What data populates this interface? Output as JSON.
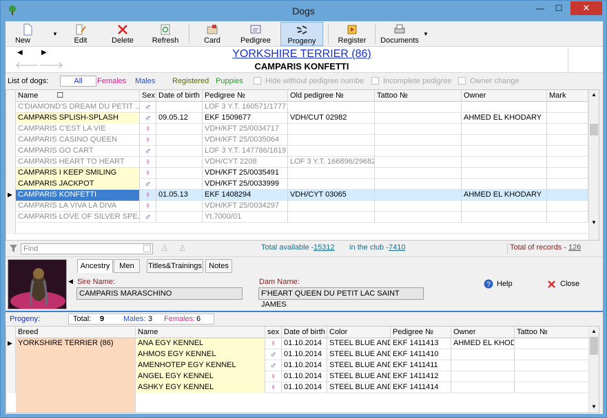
{
  "window": {
    "title": "Dogs",
    "minimize": "—",
    "maximize": "☐",
    "close": "✕"
  },
  "toolbar": {
    "new": "New",
    "edit": "Edit",
    "delete": "Delete",
    "refresh": "Refresh",
    "card": "Card",
    "pedigree": "Pedigree",
    "progeny": "Progeny",
    "register": "Register",
    "documents": "Documents"
  },
  "header": {
    "breed_title": "YORKSHIRE TERRIER (86)",
    "dog_title": "CAMPARIS KONFETTI"
  },
  "filters": {
    "label": "List of dogs:",
    "all": "All",
    "females": "Females",
    "males": "Males",
    "registered": "Registered",
    "puppies": "Puppies",
    "hide_no_pedigree": "Hide without pedigree numbe",
    "incomplete": "Incomplete pedigree",
    "owner_change": "Owner change"
  },
  "grid": {
    "columns": [
      "Name",
      "Sex",
      "Date of birth",
      "Pedigree №",
      "Old pedigree №",
      "Tattoo №",
      "Owner",
      "Mark"
    ],
    "rows": [
      {
        "name": "C'DIAMOND'S DREAM DU PETIT ...",
        "sex": "male",
        "dob": "",
        "pedigree": "LOF 3 Y.T. 160571/1777",
        "old": "",
        "tattoo": "",
        "owner": "",
        "style": "dim"
      },
      {
        "name": "CAMPARIS SPLISH-SPLASH",
        "sex": "male",
        "dob": "09.05.12",
        "pedigree": "EKF 1509677",
        "old": "VDH/CUT 02982",
        "tattoo": "",
        "owner": "AHMED EL KHODARY",
        "style": "yellow"
      },
      {
        "name": "CAMPARIS C'EST LA VIE",
        "sex": "female",
        "dob": "",
        "pedigree": "VDH/KFT 25/0034717",
        "old": "",
        "tattoo": "",
        "owner": "",
        "style": "dim"
      },
      {
        "name": "CAMPARIS CASINO QUEEN",
        "sex": "female",
        "dob": "",
        "pedigree": "VDH/KFT 25/0035064",
        "old": "",
        "tattoo": "",
        "owner": "",
        "style": "dim"
      },
      {
        "name": "CAMPARIS GO CART",
        "sex": "male",
        "dob": "",
        "pedigree": "LOF 3 Y.T. 147786/1619",
        "old": "",
        "tattoo": "",
        "owner": "",
        "style": "dim"
      },
      {
        "name": "CAMPARIS HEART TO HEART",
        "sex": "female",
        "dob": "",
        "pedigree": "VDH/CYT 2208",
        "old": "LOF 3 Y.T. 166896/29682",
        "tattoo": "",
        "owner": "",
        "style": "dim"
      },
      {
        "name": "CAMPARIS I KEEP SMILING",
        "sex": "female",
        "dob": "",
        "pedigree": "VDH/KFT 25/0035491",
        "old": "",
        "tattoo": "",
        "owner": "",
        "style": "yellow"
      },
      {
        "name": "CAMPARIS JACKPOT",
        "sex": "male",
        "dob": "",
        "pedigree": "VDH/KFT 25/0033999",
        "old": "",
        "tattoo": "",
        "owner": "",
        "style": "yellow"
      },
      {
        "name": "CAMPARIS KONFETTI",
        "sex": "female",
        "dob": "01.05.13",
        "pedigree": "EKF 1408294",
        "old": "VDH/CYT 03065",
        "tattoo": "",
        "owner": "AHMED EL KHODARY",
        "style": "selected"
      },
      {
        "name": "CAMPARIS LA VIVA LA DIVA",
        "sex": "female",
        "dob": "",
        "pedigree": "VDH/KFT 25/0034297",
        "old": "",
        "tattoo": "",
        "owner": "",
        "style": "dim"
      },
      {
        "name": "CAMPARIS LOVE OF SILVER SPE...",
        "sex": "male",
        "dob": "",
        "pedigree": "Yt.7000/01",
        "old": "",
        "tattoo": "",
        "owner": "",
        "style": "dim"
      }
    ]
  },
  "find": {
    "placeholder": "Find",
    "total_available_label": "Total available -",
    "total_available": "15312",
    "in_club_label": "in the club -",
    "in_club": "7410",
    "total_records_label": "Total of records -",
    "total_records": "126"
  },
  "detail": {
    "tabs": [
      "Ancestry",
      "Men",
      "Titles&Trainings",
      "Notes"
    ],
    "sire_label": "Sire Name:",
    "sire": "CAMPARIS MARASCHINO",
    "dam_label": "Dam Name:",
    "dam": "F'HEART QUEEN DU PETIT LAC SAINT JAMES",
    "help": "Help",
    "close": "Close"
  },
  "progeny": {
    "label": "Progeny:",
    "total_label": "Total:",
    "total": "9",
    "males_label": "Males:",
    "males": "3",
    "females_label": "Females:",
    "females": "6",
    "columns": [
      "Breed",
      "Name",
      "sex",
      "Date of birth",
      "Color",
      "Pedigree №",
      "Owner",
      "Tattoo №"
    ],
    "breed": "YORKSHIRE TERRIER (86)",
    "rows": [
      {
        "name": "ANA EGY KENNEL",
        "sex": "female",
        "dob": "01.10.2014",
        "color": "STEEL BLUE AND",
        "pedigree": "EKF 1411413",
        "owner": "AHMED EL KHOD"
      },
      {
        "name": "AHMOS EGY KENNEL",
        "sex": "male",
        "dob": "01.10.2014",
        "color": "STEEL BLUE AND",
        "pedigree": "EKF 1411410",
        "owner": ""
      },
      {
        "name": "AMENHOTEP EGY KENNEL",
        "sex": "male",
        "dob": "01.10.2014",
        "color": "STEEL BLUE AND",
        "pedigree": "EKF 1411411",
        "owner": ""
      },
      {
        "name": "ANGEL EGY KENNEL",
        "sex": "female",
        "dob": "01.10.2014",
        "color": "STEEL BLUE AND",
        "pedigree": "EKF 1411412",
        "owner": ""
      },
      {
        "name": "ASHKY EGY KENNEL",
        "sex": "female",
        "dob": "01.10.2014",
        "color": "STEEL BLUE AND",
        "pedigree": "EKF 1411414",
        "owner": ""
      }
    ]
  },
  "colors": {
    "selected": "#d5ecff",
    "yellow": "#fffdd0",
    "male": "#2a4dd6",
    "female": "#e0258c",
    "accent": "#3c7fd0"
  }
}
